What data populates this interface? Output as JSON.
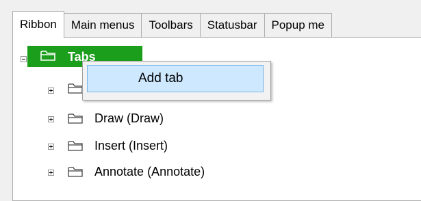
{
  "tabs": [
    {
      "label": "Ribbon",
      "active": true
    },
    {
      "label": "Main menus",
      "active": false
    },
    {
      "label": "Toolbars",
      "active": false
    },
    {
      "label": "Statusbar",
      "active": false
    },
    {
      "label": "Popup me",
      "active": false
    }
  ],
  "tree": {
    "root": {
      "label": "Tabs",
      "expanded": true,
      "selected": true
    },
    "children": [
      {
        "label": "",
        "expanded": false
      },
      {
        "label": "Draw (Draw)",
        "expanded": false
      },
      {
        "label": "Insert (Insert)",
        "expanded": false
      },
      {
        "label": "Annotate (Annotate)",
        "expanded": false
      }
    ]
  },
  "context_menu": {
    "items": [
      {
        "label": "Add tab",
        "highlighted": true
      }
    ]
  },
  "colors": {
    "selection": "#1b9e1b",
    "menu_highlight": "#cde8ff",
    "menu_highlight_border": "#79b4e6"
  },
  "icons": {
    "expander": "plus-minus-box",
    "node": "folder-outline-icon"
  }
}
